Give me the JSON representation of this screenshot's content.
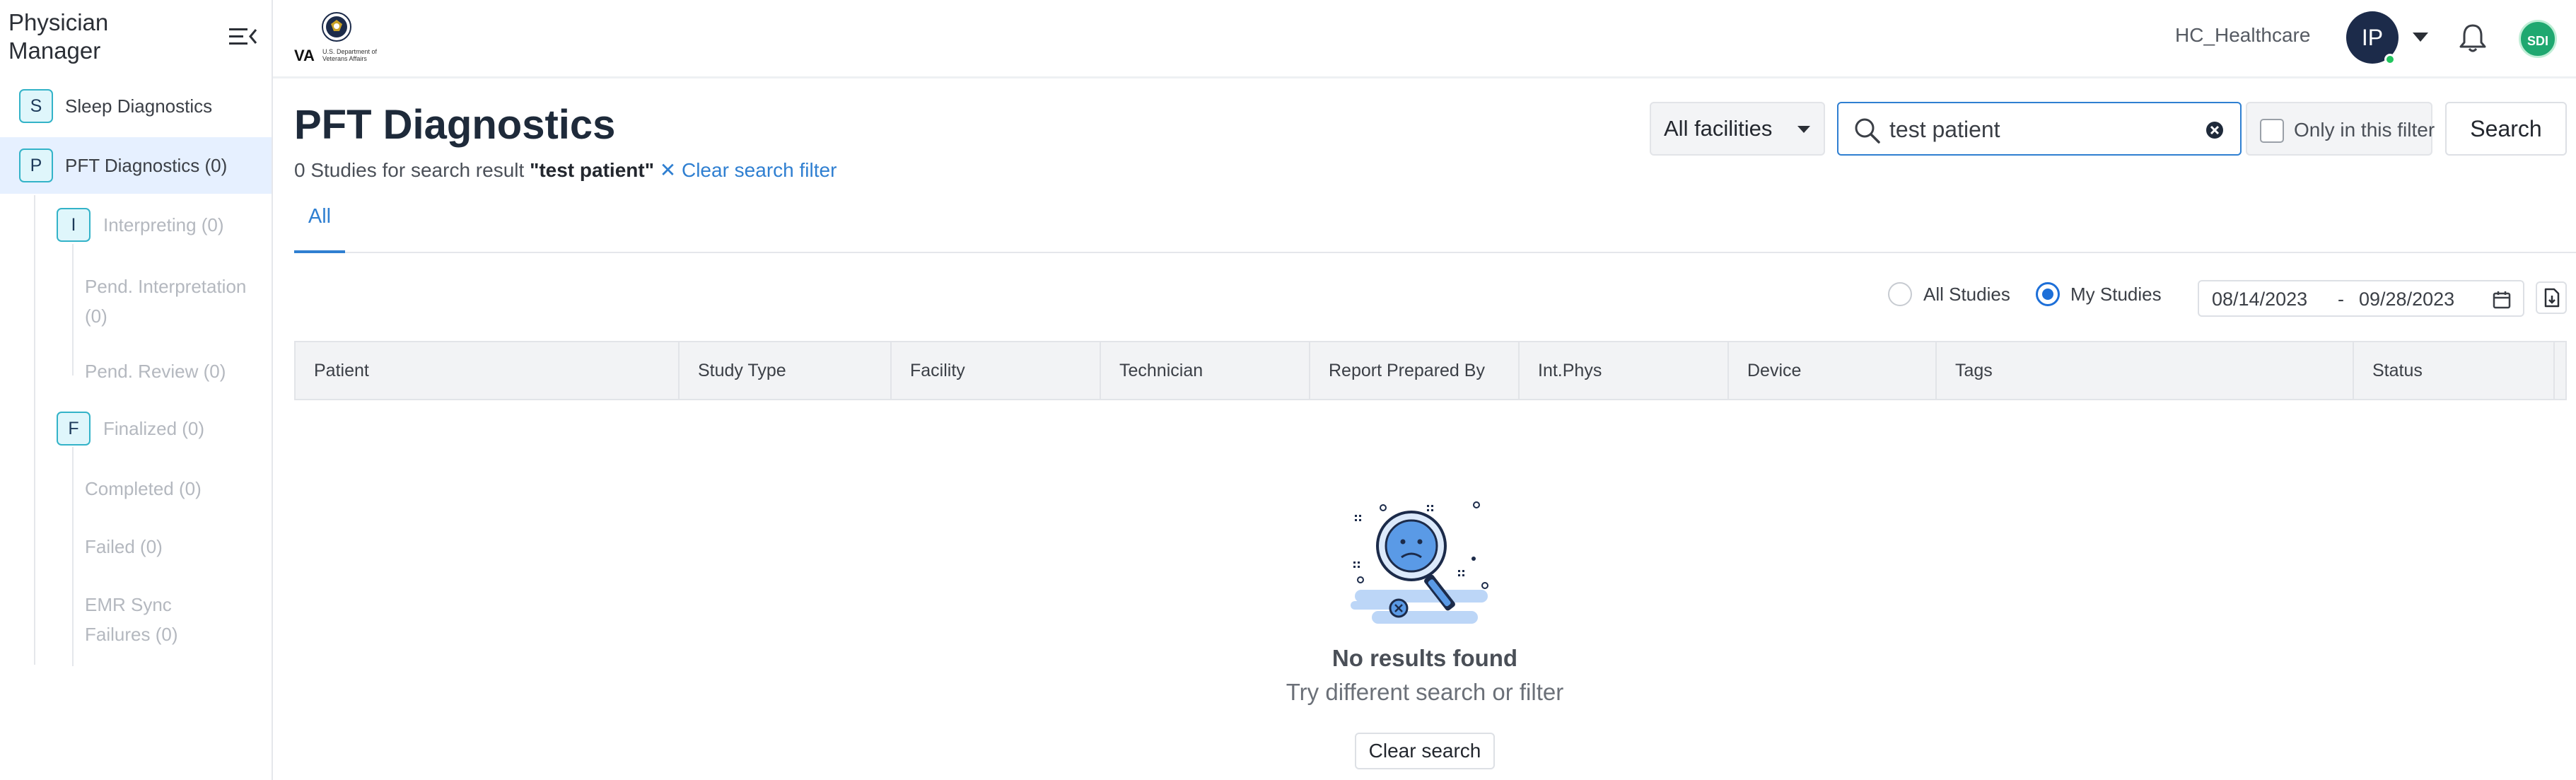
{
  "app": {
    "title": "Physician Manager"
  },
  "sidebar": {
    "items": [
      {
        "badge": "S",
        "label": "Sleep Diagnostics"
      },
      {
        "badge": "P",
        "label": "PFT Diagnostics (0)"
      },
      {
        "badge": "I",
        "label": "Interpreting (0)"
      },
      {
        "label": "Pend. Interpretation (0)"
      },
      {
        "label": "Pend. Review (0)"
      },
      {
        "badge": "F",
        "label": "Finalized (0)"
      },
      {
        "label": "Completed (0)"
      },
      {
        "label": "Failed (0)"
      },
      {
        "label": "EMR Sync Failures (0)"
      }
    ]
  },
  "header": {
    "logo_text": "VA",
    "logo_sub": "U.S. Department of Veterans Affairs",
    "org": "HC_Healthcare",
    "user_initials": "IP",
    "app_badge": "SDI"
  },
  "main": {
    "title": "PFT Diagnostics",
    "result_prefix": "0 Studies for search result",
    "result_query": "\"test patient\"",
    "clear_filter": "✕ Clear search filter",
    "facility": "All facilities",
    "search_value": "test patient",
    "only_filter": "Only in this filter",
    "search_button": "Search",
    "tabs": [
      {
        "label": "All"
      }
    ],
    "radio_all": "All Studies",
    "radio_my": "My Studies",
    "date_from": "08/14/2023",
    "date_sep": "-",
    "date_to": "09/28/2023",
    "columns": [
      "Patient",
      "Study Type",
      "Facility",
      "Technician",
      "Report Prepared By",
      "Int.Phys",
      "Device",
      "Tags",
      "Status"
    ],
    "empty_title": "No results found",
    "empty_sub": "Try different search or filter",
    "clear_search": "Clear search"
  },
  "colors": {
    "accent": "#2f7fd1",
    "badge_border": "#33b3c8",
    "active_bg": "#e6f0ff"
  }
}
